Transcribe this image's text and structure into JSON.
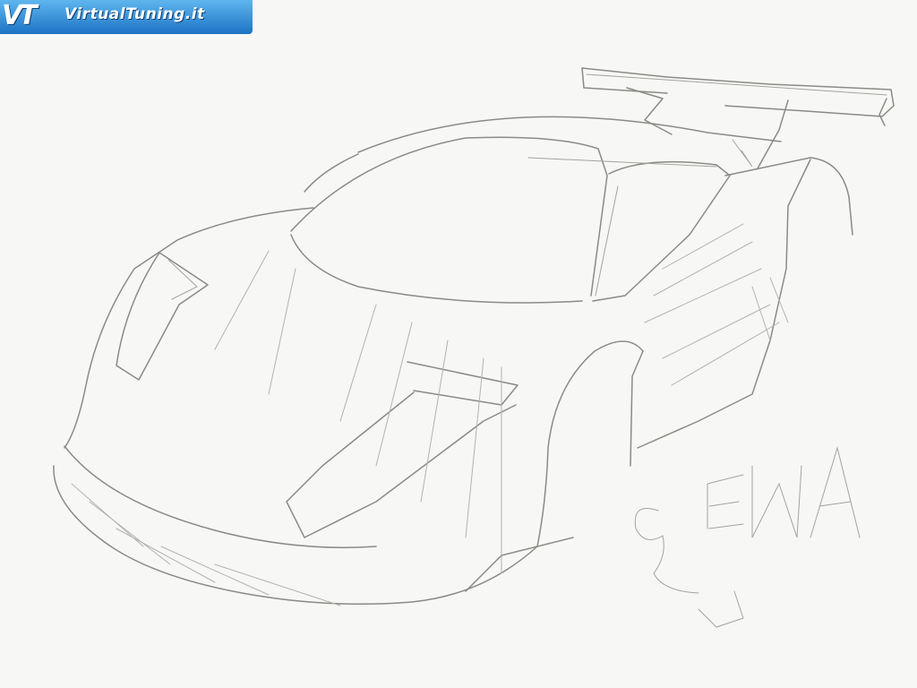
{
  "watermark": {
    "logo": "VT",
    "text": "VirtualTuning.it",
    "colors": {
      "top": "#5fb6ee",
      "bottom": "#1c73c4",
      "text": "#ffffff"
    }
  },
  "drawing": {
    "subject": "pencil sketch of a race car",
    "signature": "GEMA",
    "colors": {
      "paper": "#f7f7f5",
      "pencil": "#8a8a86"
    }
  }
}
